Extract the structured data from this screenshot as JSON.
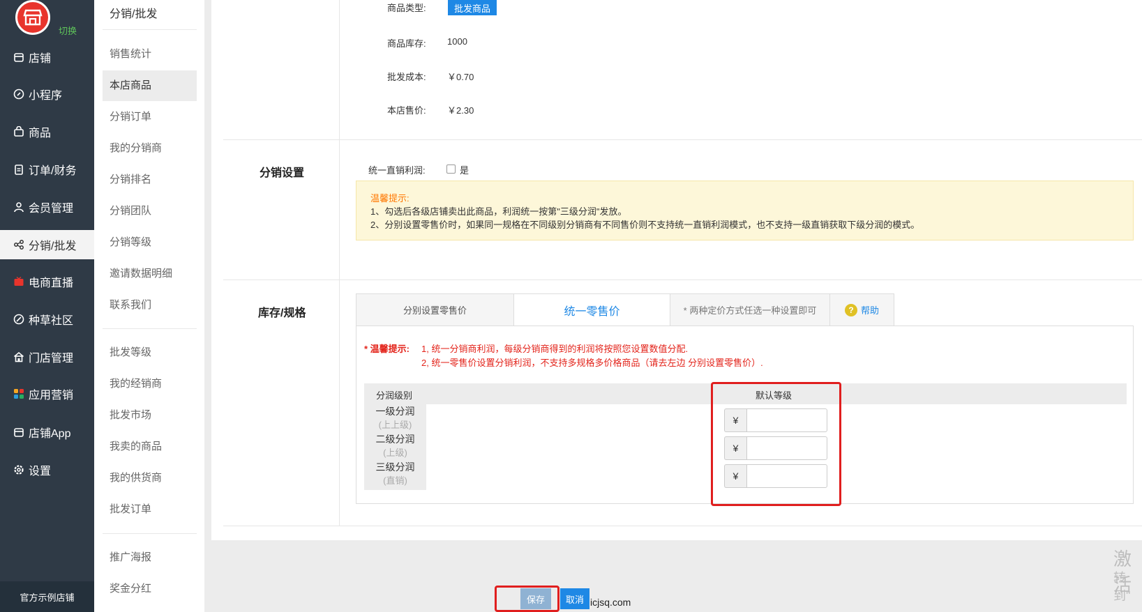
{
  "nav": {
    "switch_label": "切换",
    "items": [
      {
        "label": "店铺",
        "icon": "store-icon"
      },
      {
        "label": "小程序",
        "icon": "link-icon"
      },
      {
        "label": "商品",
        "icon": "bag-icon"
      },
      {
        "label": "订单/财务",
        "icon": "clipboard-icon"
      },
      {
        "label": "会员管理",
        "icon": "user-icon"
      },
      {
        "label": "分销/批发",
        "icon": "share-icon"
      },
      {
        "label": "电商直播",
        "icon": "tv-icon"
      },
      {
        "label": "种草社区",
        "icon": "leaf-icon"
      },
      {
        "label": "门店管理",
        "icon": "house-icon"
      },
      {
        "label": "应用营销",
        "icon": "grid-icon"
      },
      {
        "label": "店铺App",
        "icon": "app-icon"
      },
      {
        "label": "设置",
        "icon": "gear-icon"
      }
    ],
    "bottom_label": "官方示例店铺"
  },
  "submenu": {
    "title": "分销/批发",
    "group1": [
      "销售统计",
      "本店商品",
      "分销订单",
      "我的分销商",
      "分销排名",
      "分销团队",
      "分销等级",
      "邀请数据明细",
      "联系我们"
    ],
    "group2": [
      "批发等级",
      "我的经销商",
      "批发市场",
      "我卖的商品",
      "我的供货商",
      "批发订单"
    ],
    "group3": [
      "推广海报",
      "奖金分红"
    ]
  },
  "product": {
    "type_label": "商品类型:",
    "type_value": "批发商品",
    "stock_label": "商品库存:",
    "stock_value": "1000",
    "cost_label": "批发成本:",
    "cost_value": "￥0.70",
    "price_label": "本店售价:",
    "price_value": "￥2.30"
  },
  "distribution": {
    "section_title": "分销设置",
    "unify_label": "统一直销利润:",
    "unify_option": "是",
    "unify_checked": false,
    "tip_title": "温馨提示:",
    "tip_line1": "1、勾选后各级店铺卖出此商品，利润统一按第\"三级分润\"发放。",
    "tip_line2": "2、分别设置零售价时，如果同一规格在不同级别分销商有不同售价则不支持统一直销利润模式，也不支持一级直销获取下级分润的模式。"
  },
  "stock_spec": {
    "section_title": "库存/规格",
    "tabs": [
      "分别设置零售价",
      "统一零售价"
    ],
    "note": "* 两种定价方式任选一种设置即可",
    "help_label": "帮助",
    "warn_title": "* 温馨提示:",
    "warn_line1": "1, 统一分销商利润，每级分销商得到的利润将按照您设置数值分配.",
    "warn_line2": "2, 统一零售价设置分销利润，不支持多规格多价格商品（请去左边 分别设置零售价）.",
    "col_level": "分润级别",
    "col_default": "默认等级",
    "levels": [
      {
        "name": "一级分润",
        "sub": "(上上级)"
      },
      {
        "name": "二级分润",
        "sub": "(上级)"
      },
      {
        "name": "三级分润",
        "sub": "(直销)"
      }
    ],
    "currency": "¥",
    "inputs": [
      "",
      "",
      ""
    ]
  },
  "footer": {
    "save_label": "保存",
    "cancel_label": "取消",
    "domain_text": "icjsq.com",
    "watermark_line1": "激活",
    "watermark_line2": "转到\""
  },
  "colors": {
    "nav_bg": "#2f3a46",
    "accent": "#1e88e5",
    "logo_red": "#e8342c",
    "highlight_red": "#e01e1e",
    "warning_orange": "#ff7700"
  }
}
